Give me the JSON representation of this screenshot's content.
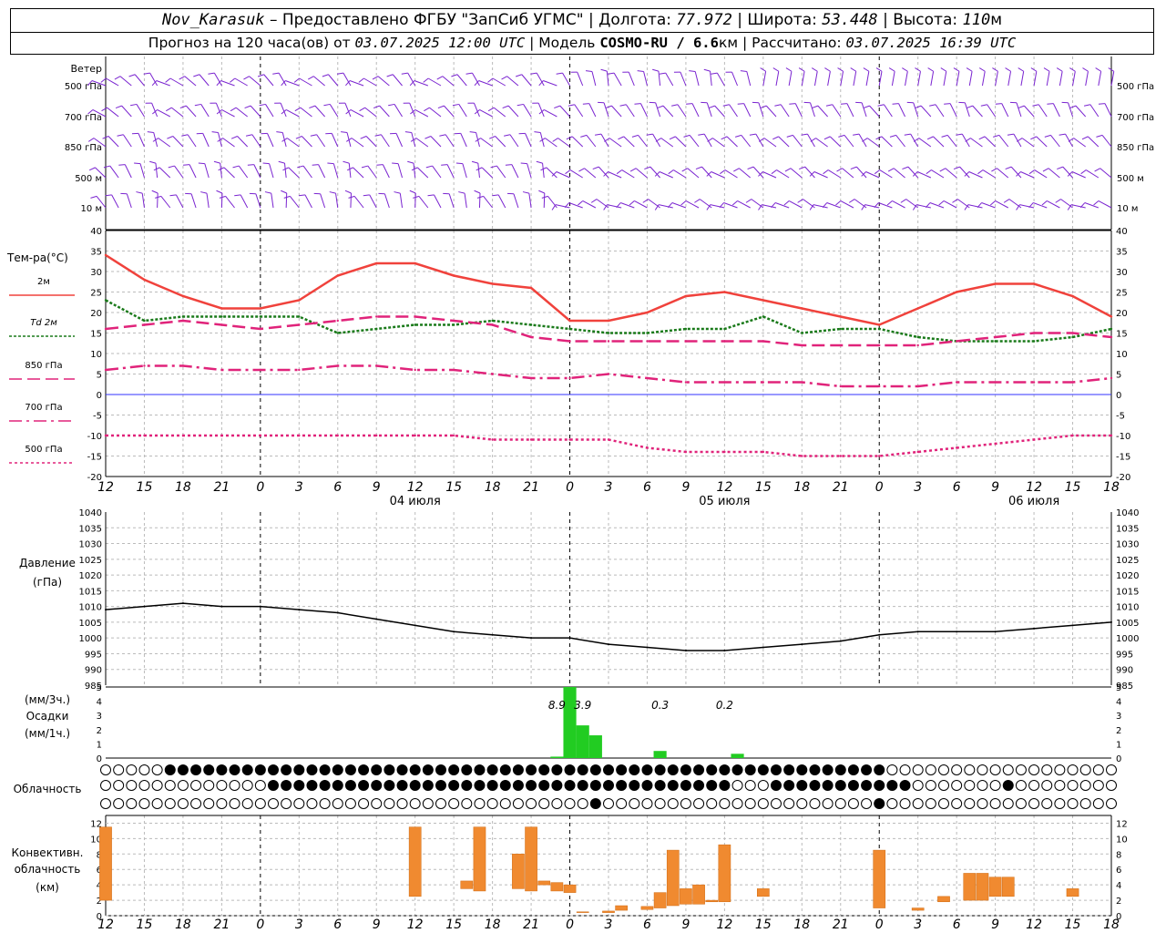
{
  "header": {
    "station": "Nov_Karasuk",
    "provider": " – Предоставлено ФГБУ \"ЗапСиб УГМС\" | Долгота: ",
    "lon": "77.972",
    "lat_label": " | Широта: ",
    "lat": "53.448",
    "alt_label": " | Высота: ",
    "alt": "110",
    "alt_unit": "м",
    "fc_prefix": "Прогноз на 120 часа(ов) от ",
    "fc_date": "03.07.2025 12:00 UTC",
    "model_label": "  | Модель ",
    "model": "COSMO-RU / 6.6",
    "model_unit": "км",
    "calc_label": " | Рассчитано: ",
    "calc_date": "03.07.2025 16:39 UTC"
  },
  "colors": {
    "t2m": "#f0423c",
    "td": "#1a7a1a",
    "t850": "#e0237a",
    "wind": "#7a24d0",
    "precip": "#22cc22",
    "conv": "#f08a30",
    "zero": "#3333ff"
  },
  "labels": {
    "wind_title": "Ветер",
    "wind_levels": [
      "500 гПа",
      "700 гПа",
      "850 гПа",
      "500 м",
      "10  м"
    ],
    "temp_title": "Тем-ра(°С)",
    "legend": [
      "2м",
      "Td  2м",
      "850 гПа",
      "700 гПа",
      "500 гПа"
    ],
    "pressure_title": "Давление",
    "pressure_unit": "(гПа)",
    "precip_unit3": "(мм/3ч.)",
    "precip_title": "Осадки",
    "precip_unit1": "(мм/1ч.)",
    "cloud_title": "Облачность",
    "conv_title": "Конвективн.",
    "conv_title2": "облачность",
    "conv_unit": "(км)"
  },
  "time_axis": {
    "start": "03.07.2025 12 UTC",
    "tick_labels": [
      "12",
      "15",
      "18",
      "21",
      "0",
      "3",
      "6",
      "9",
      "12",
      "15",
      "18",
      "21",
      "0",
      "3",
      "6",
      "9",
      "12",
      "15",
      "18",
      "21",
      "0",
      "3",
      "6",
      "9",
      "12",
      "15",
      "18"
    ],
    "day_labels": [
      "04 июля",
      "05 июля",
      "06 июля"
    ]
  },
  "chart_data": [
    {
      "type": "line",
      "title": "Тем-ра(°С)",
      "ylim": [
        -20,
        40
      ],
      "yticks": [
        "40",
        "35",
        "30",
        "25",
        "20",
        "15",
        "10",
        "5",
        "0",
        "-5",
        "-10",
        "-15",
        "-20"
      ],
      "x_hours": [
        0,
        3,
        6,
        9,
        12,
        15,
        18,
        21,
        24,
        27,
        30,
        33,
        36,
        39,
        42,
        45,
        48,
        51,
        54,
        57,
        60,
        63,
        66,
        69,
        72,
        75,
        78
      ],
      "series": [
        {
          "name": "2м",
          "values": [
            34,
            28,
            24,
            21,
            21,
            23,
            29,
            32,
            32,
            29,
            27,
            26,
            18,
            18,
            20,
            24,
            25,
            23,
            21,
            19,
            17,
            21,
            25,
            27,
            27,
            24,
            19
          ]
        },
        {
          "name": "Td  2м",
          "values": [
            23,
            18,
            19,
            19,
            19,
            19,
            15,
            16,
            17,
            17,
            18,
            17,
            16,
            15,
            15,
            16,
            16,
            19,
            15,
            16,
            16,
            14,
            13,
            13,
            13,
            14,
            16
          ]
        },
        {
          "name": "850 гПа",
          "values": [
            16,
            17,
            18,
            17,
            16,
            17,
            18,
            19,
            19,
            18,
            17,
            14,
            13,
            13,
            13,
            13,
            13,
            13,
            12,
            12,
            12,
            12,
            13,
            14,
            15,
            15,
            14
          ]
        },
        {
          "name": "700 гПа",
          "values": [
            6,
            7,
            7,
            6,
            6,
            6,
            7,
            7,
            6,
            6,
            5,
            4,
            4,
            5,
            4,
            3,
            3,
            3,
            3,
            2,
            2,
            2,
            3,
            3,
            3,
            3,
            4
          ]
        },
        {
          "name": "500 гПа",
          "values": [
            -10,
            -10,
            -10,
            -10,
            -10,
            -10,
            -10,
            -10,
            -10,
            -10,
            -11,
            -11,
            -11,
            -11,
            -13,
            -14,
            -14,
            -14,
            -15,
            -15,
            -15,
            -14,
            -13,
            -12,
            -11,
            -10,
            -10
          ]
        }
      ]
    },
    {
      "type": "line",
      "title": "Давление",
      "ylabel": "(гПа)",
      "ylim": [
        985,
        1040
      ],
      "yticks": [
        "1040",
        "1035",
        "1030",
        "1025",
        "1020",
        "1015",
        "1010",
        "1005",
        "1000",
        "995",
        "990",
        "985"
      ],
      "x_hours": [
        0,
        3,
        6,
        9,
        12,
        15,
        18,
        21,
        24,
        27,
        30,
        33,
        36,
        39,
        42,
        45,
        48,
        51,
        54,
        57,
        60,
        63,
        66,
        69,
        72,
        75,
        78
      ],
      "values": [
        1009,
        1010,
        1011,
        1010,
        1010,
        1009,
        1008,
        1006,
        1004,
        1002,
        1001,
        1000,
        1000,
        998,
        997,
        996,
        996,
        997,
        998,
        999,
        1001,
        1002,
        1002,
        1002,
        1003,
        1004,
        1005
      ]
    },
    {
      "type": "bar",
      "title": "Осадки",
      "ylabel": "(мм/1ч.)",
      "ylim": [
        0,
        5
      ],
      "yticks": [
        "5",
        "4",
        "3",
        "2",
        "1",
        "0"
      ],
      "x_hours": [
        35,
        36,
        37,
        38,
        43,
        49
      ],
      "values": [
        0.1,
        5.6,
        2.3,
        1.6,
        0.5,
        0.3
      ],
      "accum_labels": [
        "8.9",
        "3.9",
        "0.3",
        "0.2"
      ],
      "accum_hours": [
        35,
        37,
        43,
        48
      ]
    },
    {
      "type": "bar",
      "title": "Конвективн. облачность",
      "ylabel": "(км)",
      "ylim": [
        0,
        13
      ],
      "yticks": [
        "12",
        "10",
        "8",
        "6",
        "4",
        "2",
        "0"
      ],
      "bars": [
        {
          "h": 0,
          "base": 2,
          "top": 11.5
        },
        {
          "h": 24,
          "base": 2.5,
          "top": 11.5
        },
        {
          "h": 28,
          "base": 3.5,
          "top": 4.5
        },
        {
          "h": 29,
          "base": 3.2,
          "top": 11.5
        },
        {
          "h": 32,
          "base": 3.5,
          "top": 8
        },
        {
          "h": 33,
          "base": 3.2,
          "top": 11.5
        },
        {
          "h": 34,
          "base": 4,
          "top": 4.5
        },
        {
          "h": 35,
          "base": 3.2,
          "top": 4.3
        },
        {
          "h": 36,
          "base": 3,
          "top": 4
        },
        {
          "h": 37,
          "base": 0.4,
          "top": 0.5
        },
        {
          "h": 39,
          "base": 0.4,
          "top": 0.6
        },
        {
          "h": 40,
          "base": 0.7,
          "top": 1.3
        },
        {
          "h": 42,
          "base": 0.8,
          "top": 1.2
        },
        {
          "h": 43,
          "base": 1,
          "top": 3
        },
        {
          "h": 44,
          "base": 1.3,
          "top": 8.5
        },
        {
          "h": 45,
          "base": 1.5,
          "top": 3.5
        },
        {
          "h": 46,
          "base": 1.5,
          "top": 4
        },
        {
          "h": 47,
          "base": 1.8,
          "top": 2
        },
        {
          "h": 48,
          "base": 1.8,
          "top": 9.2
        },
        {
          "h": 51,
          "base": 2.5,
          "top": 3.5
        },
        {
          "h": 60,
          "base": 1,
          "top": 8.5
        },
        {
          "h": 63,
          "base": 0.7,
          "top": 1
        },
        {
          "h": 65,
          "base": 1.8,
          "top": 2.5
        },
        {
          "h": 67,
          "base": 2,
          "top": 5.5
        },
        {
          "h": 68,
          "base": 2,
          "top": 5.5
        },
        {
          "h": 69,
          "base": 2.5,
          "top": 5
        },
        {
          "h": 70,
          "base": 2.5,
          "top": 5
        },
        {
          "h": 75,
          "base": 2.5,
          "top": 3.5
        }
      ]
    }
  ]
}
